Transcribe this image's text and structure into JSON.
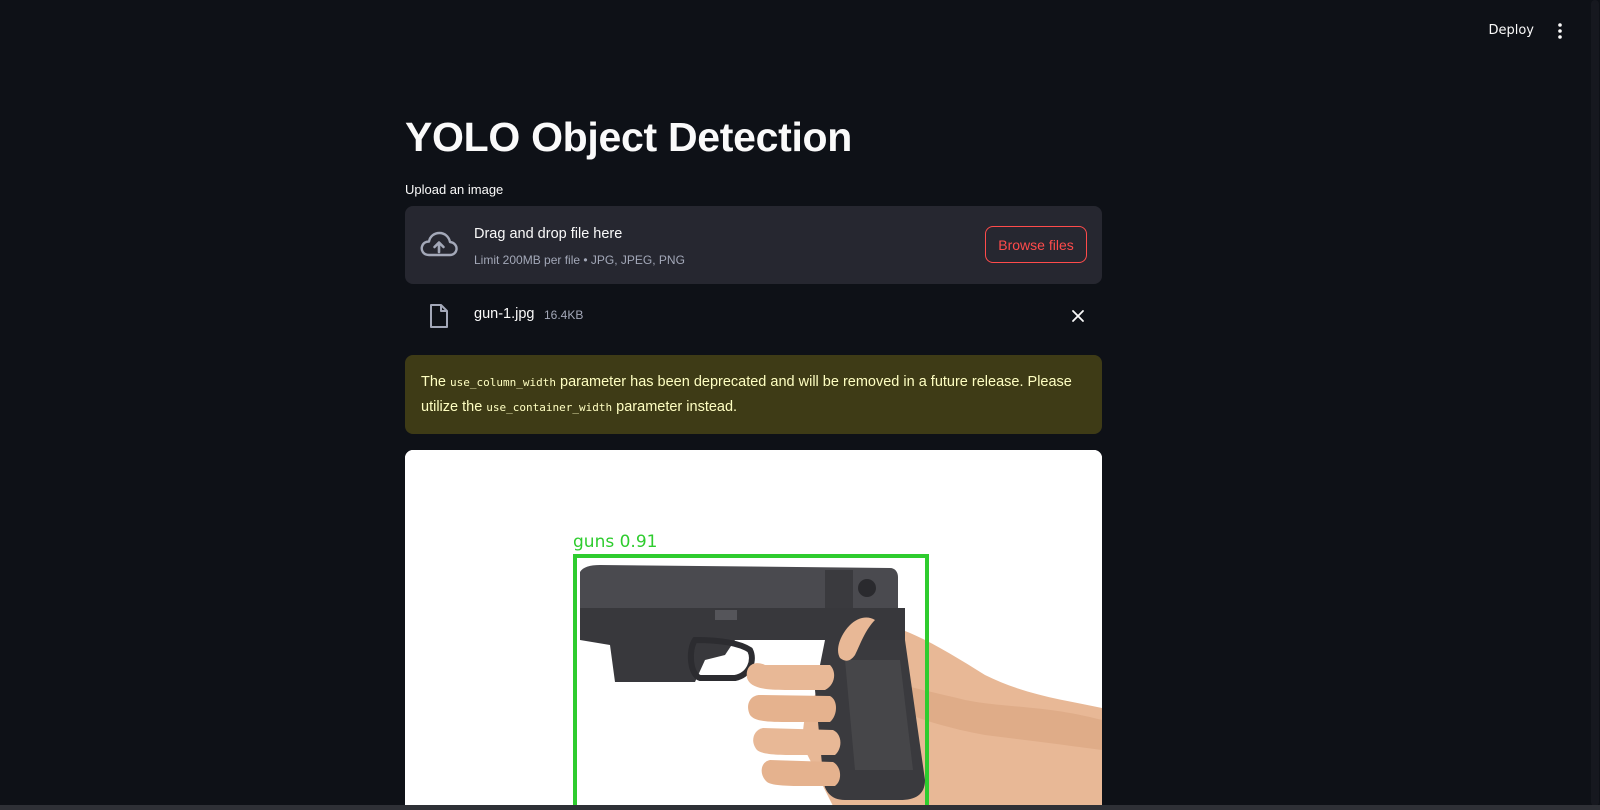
{
  "header": {
    "deploy_label": "Deploy",
    "menu_icon": "vertical-ellipsis-icon"
  },
  "main": {
    "title": "YOLO Object Detection",
    "uploader": {
      "label": "Upload an image",
      "drop_title": "Drag and drop file here",
      "limit_text": "Limit 200MB per file • JPG, JPEG, PNG",
      "browse_label": "Browse files",
      "icon": "cloud-upload-icon"
    },
    "uploaded_file": {
      "name": "gun-1.jpg",
      "size": "16.4KB",
      "icon": "file-icon",
      "remove_icon": "close-icon"
    },
    "warning": {
      "text_before": "The ",
      "code_1": "use_column_width",
      "text_middle": " parameter has been deprecated and will be removed in a future release. Please utilize the ",
      "code_2": "use_container_width",
      "text_after": " parameter instead."
    },
    "detection": {
      "label": "guns 0.91",
      "box_color": "#2ecc2e"
    }
  },
  "colors": {
    "background": "#0e1117",
    "surface": "#262730",
    "accent": "#ff4b4b",
    "warning_bg": "#3e3b16",
    "warning_text": "#ffffc2"
  }
}
